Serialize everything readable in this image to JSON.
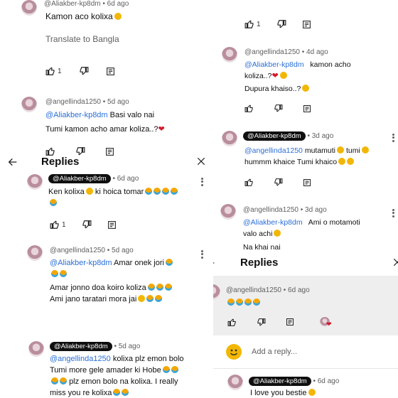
{
  "panel1": {
    "c1": {
      "author": "@Aliakber-kp8dm",
      "time": "• 6d ago",
      "text": "Kamon aco kolixa",
      "translate": "Translate to Bangla",
      "likes": "1"
    },
    "c2": {
      "author": "@angellinda1250",
      "time": "• 5d ago",
      "mention": "@Aliakber-kp8dm",
      "text1": "Basi valo nai",
      "text2": "Tumi kamon acho amar koliza..?"
    },
    "header": {
      "title": "Replies"
    },
    "r1": {
      "author": "@Aliakber-kp8dm",
      "time": "• 6d ago",
      "text": "Ken kolixa",
      "text_b": "ki hoica tomar",
      "likes": "1"
    },
    "r2": {
      "author": "@angellinda1250",
      "time": "• 5d ago",
      "mention": "@Aliakber-kp8dm",
      "text1": "Amar onek jori",
      "text2": "Amar jonno doa koiro koliza",
      "text3": "Ami jano taratari mora jai"
    },
    "r3": {
      "author": "@Aliakber-kp8dm",
      "time": "• 5d ago",
      "mention": "@angellinda1250",
      "text1": "kolixa plz emon bolo",
      "text2": "Tumi more gele amader ki Hobe",
      "text3": "plz emon bolo na kolixa. I really",
      "text4": "miss you re kolixa"
    }
  },
  "panel2": {
    "top": {
      "likes": "1"
    },
    "c1": {
      "author": "@angellinda1250",
      "time": "• 4d ago",
      "mention": "@Aliakber-kp8dm",
      "text1": "kamon acho",
      "text2": "koliza..?",
      "text3": "Dupura khaiso..?"
    },
    "c2": {
      "author": "@Aliakber-kp8dm",
      "time": "• 3d ago",
      "mention": "@angellinda1250",
      "text1": "mutamuti",
      "text1b": "tumi",
      "text2": "hummm khaice Tumi khaico"
    },
    "c3": {
      "author": "@angellinda1250",
      "time": "• 3d ago",
      "mention": "@Aliakber-kp8dm",
      "text1": "Ami o motamoti",
      "text2": "valo achi",
      "text3": "Na khai nai"
    },
    "header": {
      "title": "Replies"
    },
    "r1": {
      "author": "@angellinda1250",
      "time": "• 6d ago"
    },
    "add_reply": {
      "placeholder": "Add a reply..."
    },
    "r2": {
      "author": "@Aliakber-kp8dm",
      "time": "• 6d ago",
      "text": "I love you bestie"
    }
  },
  "colors": {
    "mention": "#2a6fd6",
    "chip": "#0f0f0f",
    "heart": "#d21b2e",
    "highlight": "#eeeeee"
  },
  "icons": [
    "thumb-up-icon",
    "thumb-down-icon",
    "reply-icon",
    "back-arrow-icon",
    "close-icon",
    "more-vert-icon",
    "smiley-icon",
    "heart-icon"
  ]
}
